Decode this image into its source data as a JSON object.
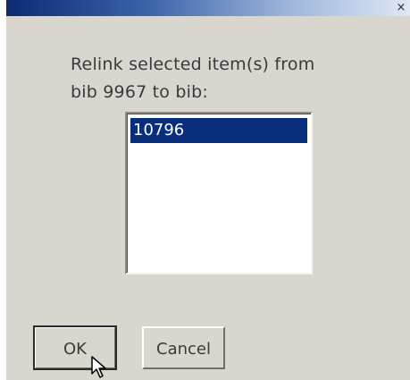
{
  "window": {
    "close_glyph": "×"
  },
  "dialog": {
    "prompt": "Relink selected item(s) from\nbib 9967 to bib:"
  },
  "list": {
    "items": [
      "10796"
    ],
    "selected_index": 0
  },
  "buttons": {
    "ok_label": "OK",
    "cancel_label": "Cancel"
  },
  "colors": {
    "dialog_bg": "#d9d6cf",
    "selection_bg": "#0a2e7e",
    "titlebar_start": "#0c2a72"
  },
  "icons": {
    "cursor": "mouse-pointer-icon"
  }
}
